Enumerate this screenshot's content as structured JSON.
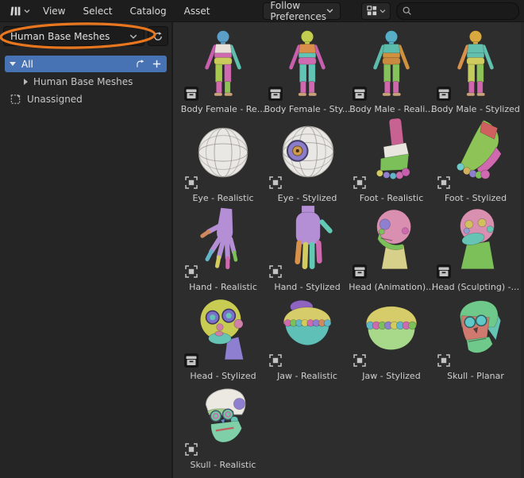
{
  "header": {
    "editor_type": "asset-browser",
    "menus": [
      {
        "label": "View"
      },
      {
        "label": "Select"
      },
      {
        "label": "Catalog"
      },
      {
        "label": "Asset"
      }
    ],
    "import_method": {
      "label": "Follow Preferences"
    },
    "search": {
      "value": "",
      "placeholder": ""
    }
  },
  "sidebar": {
    "library": {
      "selected": "Human Base Meshes"
    },
    "catalogs": [
      {
        "label": "All",
        "selected": true,
        "expanded": true
      },
      {
        "label": "Human Base Meshes",
        "indent": 1,
        "collapsed": true
      },
      {
        "label": "Unassigned"
      }
    ]
  },
  "assets": {
    "columns": 4,
    "items": [
      {
        "label": "Body Female - Re...",
        "id_type": "collection",
        "thumb": "body_f_real"
      },
      {
        "label": "Body Female - Sty...",
        "id_type": "collection",
        "thumb": "body_f_sty"
      },
      {
        "label": "Body Male - Reali...",
        "id_type": "collection",
        "thumb": "body_m_real"
      },
      {
        "label": "Body Male - Stylized",
        "id_type": "collection",
        "thumb": "body_m_sty"
      },
      {
        "label": "Eye - Realistic",
        "id_type": "object",
        "thumb": "eye_real"
      },
      {
        "label": "Eye - Stylized",
        "id_type": "object",
        "thumb": "eye_sty"
      },
      {
        "label": "Foot - Realistic",
        "id_type": "object",
        "thumb": "foot_real"
      },
      {
        "label": "Foot - Stylized",
        "id_type": "object",
        "thumb": "foot_sty"
      },
      {
        "label": "Hand  - Realistic",
        "id_type": "object",
        "thumb": "hand_real"
      },
      {
        "label": "Hand - Stylized",
        "id_type": "object",
        "thumb": "hand_sty"
      },
      {
        "label": "Head (Animation)...",
        "id_type": "collection",
        "thumb": "head_anim"
      },
      {
        "label": "Head (Sculpting) -...",
        "id_type": "collection",
        "thumb": "head_sculpt"
      },
      {
        "label": "Head - Stylized",
        "id_type": "collection",
        "thumb": "head_sty"
      },
      {
        "label": "Jaw - Realistic",
        "id_type": "object",
        "thumb": "jaw_real"
      },
      {
        "label": "Jaw - Stylized",
        "id_type": "object",
        "thumb": "jaw_sty"
      },
      {
        "label": "Skull - Planar",
        "id_type": "object",
        "thumb": "skull_planar"
      },
      {
        "label": "Skull - Realistic",
        "id_type": "object",
        "thumb": "skull_real"
      }
    ]
  },
  "colors": {
    "accent": "#4772b3",
    "annotation": "#e8761e",
    "header_bg": "#1d1d1d",
    "sidebar_bg": "#252525",
    "main_bg": "#2d2d2d"
  }
}
